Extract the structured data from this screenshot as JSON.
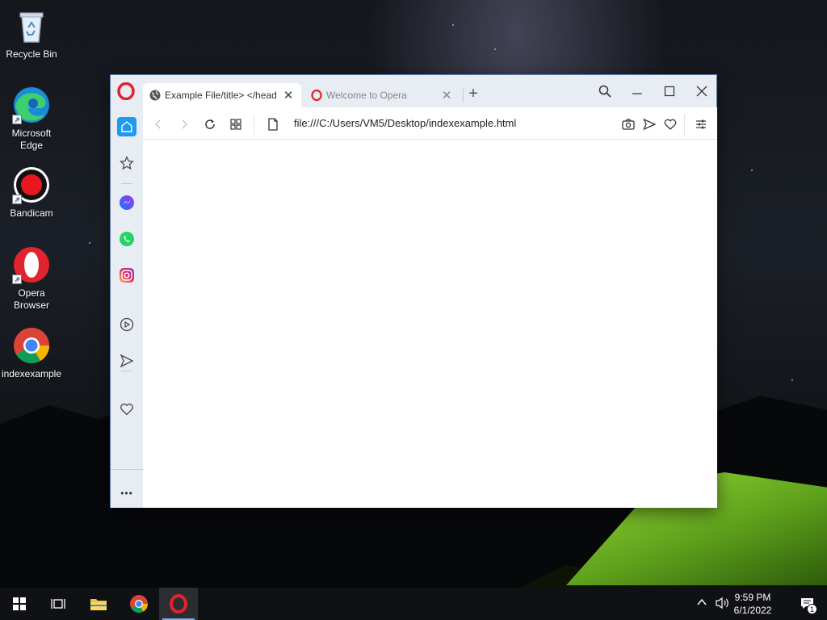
{
  "desktop": {
    "icons": [
      {
        "label": "Recycle Bin",
        "icon": "recycle-bin-icon"
      },
      {
        "label": "Microsoft Edge",
        "icon": "edge-icon"
      },
      {
        "label": "Bandicam",
        "icon": "bandicam-icon"
      },
      {
        "label": "Opera Browser",
        "icon": "opera-icon"
      },
      {
        "label": "indexexample",
        "icon": "chrome-icon"
      }
    ]
  },
  "browser": {
    "tabs": [
      {
        "title": "Example File/title> </head",
        "active": true,
        "favicon": "globe-icon"
      },
      {
        "title": "Welcome to Opera",
        "active": false,
        "favicon": "opera-icon"
      }
    ],
    "new_tab_symbol": "+",
    "address": "file:///C:/Users/VM5/Desktop/indexexample.html",
    "sidebar": [
      "home-icon",
      "star-icon",
      "messenger-icon",
      "whatsapp-icon",
      "instagram-icon",
      "player-icon",
      "send-icon",
      "heart-icon",
      "more-icon"
    ],
    "sidebar_more": "•••",
    "accent": "#1e9af0",
    "brand_red": "#e0232f"
  },
  "taskbar": {
    "time": "9:59 PM",
    "date": "6/1/2022",
    "notification_count": "1",
    "pinned": [
      "start-icon",
      "task-view-icon",
      "file-explorer-icon",
      "chrome-icon",
      "opera-icon"
    ]
  }
}
